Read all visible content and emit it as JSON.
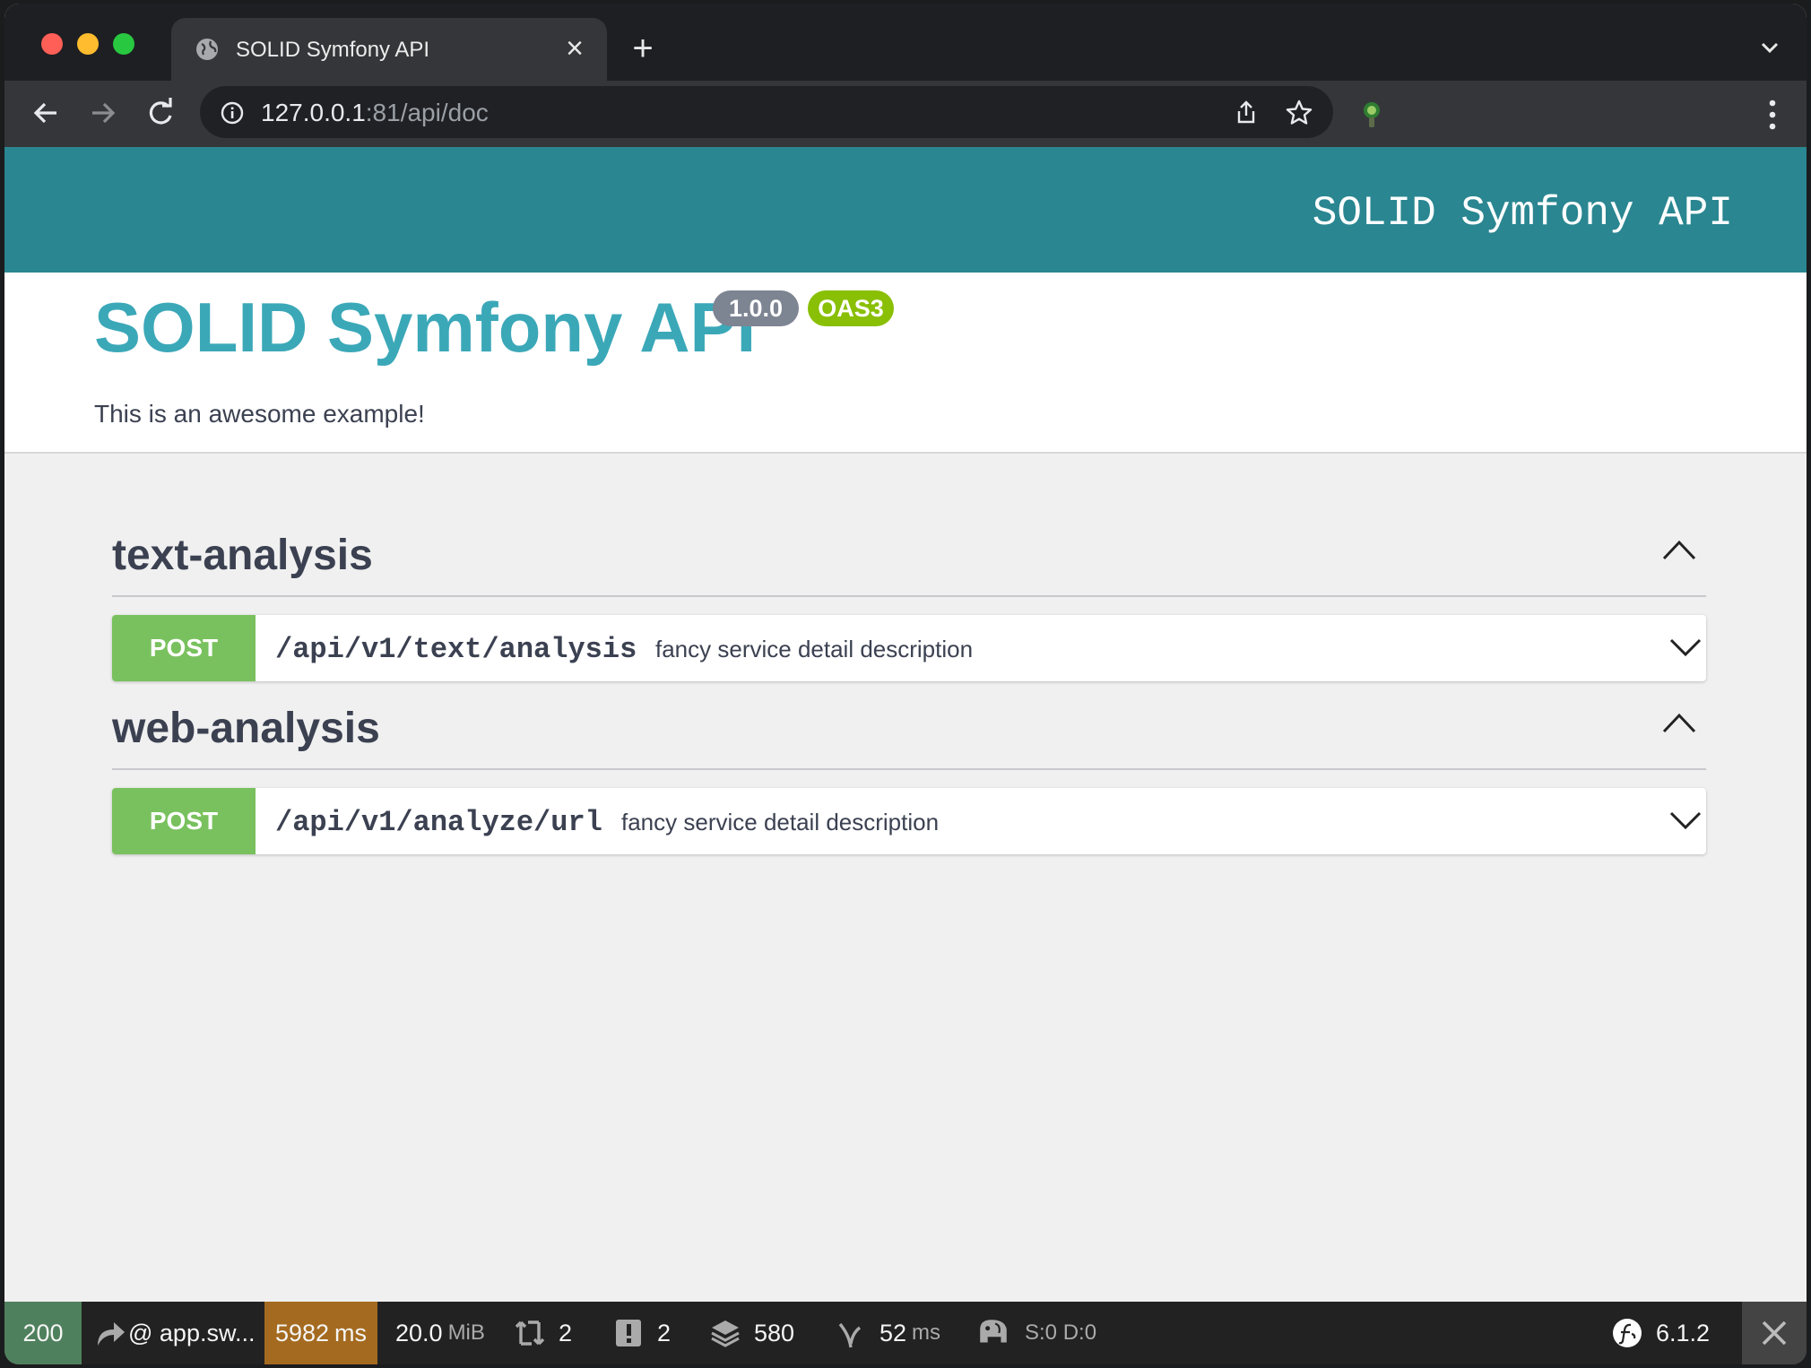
{
  "browser": {
    "tab_title": "SOLID Symfony API",
    "url_host": "127.0.0.1",
    "url_rest": ":81/api/doc"
  },
  "swagger": {
    "topbar_title": "SOLID Symfony API",
    "title": "SOLID Symfony API",
    "version_badge": "1.0.0",
    "oas_badge": "OAS3",
    "description": "This is an awesome example!",
    "tags": [
      {
        "name": "text-analysis",
        "operations": [
          {
            "method": "POST",
            "path": "/api/v1/text/analysis",
            "summary": "fancy service detail description"
          }
        ]
      },
      {
        "name": "web-analysis",
        "operations": [
          {
            "method": "POST",
            "path": "/api/v1/analyze/url",
            "summary": "fancy service detail description"
          }
        ]
      }
    ]
  },
  "debug_toolbar": {
    "status": "200",
    "route": "@ app.sw...",
    "time_value": "5982",
    "time_unit": "ms",
    "memory_value": "20.0",
    "memory_unit": "MiB",
    "requests": "2",
    "logs": "2",
    "twig": "580",
    "cache_value": "52",
    "cache_unit": "ms",
    "doctrine": "S:0 D:0",
    "symfony_version": "6.1.2"
  }
}
